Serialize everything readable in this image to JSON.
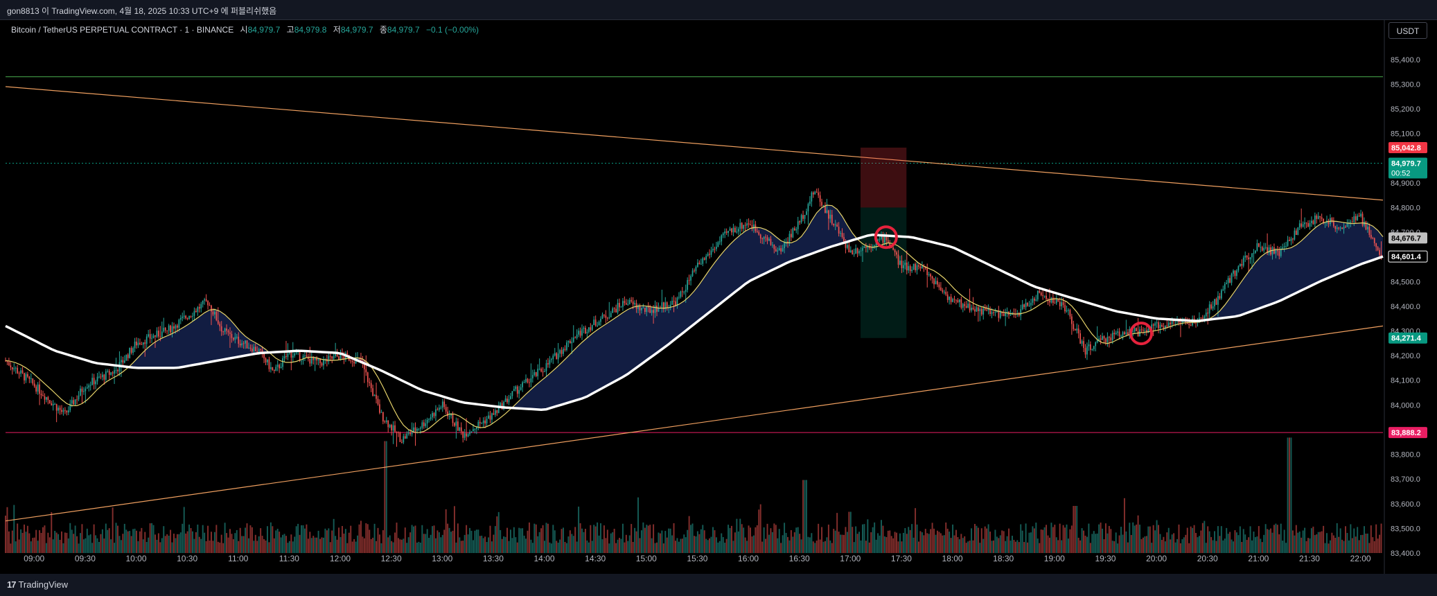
{
  "header": {
    "publish_text": "gon8813 이 TradingView.com, 4월 18, 2025 10:33 UTC+9 에 퍼블리쉬했음"
  },
  "legend": {
    "symbol": "Bitcoin / TetherUS PERPETUAL CONTRACT · 1 · BINANCE",
    "open_label": "시",
    "open": "84,979.7",
    "high_label": "고",
    "high": "84,979.8",
    "low_label": "저",
    "low": "84,979.7",
    "close_label": "종",
    "close": "84,979.7",
    "change": "−0.1 (−0.00%)"
  },
  "price_scale": {
    "unit": "USDT"
  },
  "footer": {
    "brand": "TradingView",
    "logo_mark": "17"
  },
  "colors": {
    "background": "#000000",
    "candle_up": "#26a69a",
    "candle_down": "#ef5350",
    "ema_slow": "#ffffff",
    "ema_fast": "#e6d36a",
    "cloud": "#1a2a5e",
    "trendline": "#f0a060",
    "horizontal_support": "#e91e63",
    "horizontal_top": "#4caf50",
    "marker_circle": "#e5223c"
  },
  "chart_data": {
    "type": "candlestick",
    "symbol": "BTCUSDT.P",
    "timeframe": "1",
    "y_axis": {
      "ylim": [
        83400,
        85450
      ],
      "ticks": [
        "85,400.0",
        "85,300.0",
        "85,200.0",
        "85,100.0",
        "84,900.0",
        "84,800.0",
        "84,700.0",
        "84,500.0",
        "84,400.0",
        "84,300.0",
        "84,200.0",
        "84,100.0",
        "84,000.0",
        "83,800.0",
        "83,700.0",
        "83,600.0",
        "83,500.0",
        "83,400.0"
      ],
      "tick_values": [
        85400,
        85300,
        85200,
        85100,
        84900,
        84800,
        84700,
        84500,
        84400,
        84300,
        84200,
        84100,
        84000,
        83800,
        83700,
        83600,
        83500,
        83400
      ]
    },
    "x_axis": {
      "ticks": [
        "09:00",
        "09:30",
        "10:00",
        "10:30",
        "11:00",
        "11:30",
        "12:00",
        "12:30",
        "13:00",
        "13:30",
        "14:00",
        "14:30",
        "15:00",
        "15:30",
        "16:00",
        "16:30",
        "17:00",
        "17:30",
        "18:00",
        "18:30",
        "19:00",
        "19:30",
        "20:00",
        "20:30",
        "21:00",
        "21:30",
        "22:00"
      ],
      "tick_hours": [
        9,
        9.5,
        10,
        10.5,
        11,
        11.5,
        12,
        12.5,
        13,
        13.5,
        14,
        14.5,
        15,
        15.5,
        16,
        16.5,
        17,
        17.5,
        18,
        18.5,
        19,
        19.5,
        20,
        20.5,
        21,
        21.5,
        22
      ]
    },
    "time_range": [
      8.72,
      22.22
    ],
    "price_path": [
      [
        8.72,
        84180
      ],
      [
        9.0,
        84080
      ],
      [
        9.3,
        83960
      ],
      [
        9.5,
        84080
      ],
      [
        9.8,
        84140
      ],
      [
        10.0,
        84250
      ],
      [
        10.3,
        84300
      ],
      [
        10.5,
        84360
      ],
      [
        10.7,
        84420
      ],
      [
        10.85,
        84300
      ],
      [
        11.0,
        84260
      ],
      [
        11.2,
        84220
      ],
      [
        11.35,
        84130
      ],
      [
        11.5,
        84210
      ],
      [
        11.8,
        84170
      ],
      [
        12.0,
        84200
      ],
      [
        12.2,
        84180
      ],
      [
        12.4,
        83960
      ],
      [
        12.6,
        83860
      ],
      [
        12.8,
        83920
      ],
      [
        13.0,
        84000
      ],
      [
        13.2,
        83880
      ],
      [
        13.5,
        83960
      ],
      [
        13.7,
        84050
      ],
      [
        14.0,
        84150
      ],
      [
        14.3,
        84280
      ],
      [
        14.6,
        84360
      ],
      [
        14.8,
        84420
      ],
      [
        15.0,
        84380
      ],
      [
        15.3,
        84420
      ],
      [
        15.5,
        84560
      ],
      [
        15.8,
        84700
      ],
      [
        16.0,
        84740
      ],
      [
        16.3,
        84620
      ],
      [
        16.5,
        84740
      ],
      [
        16.65,
        84870
      ],
      [
        16.8,
        84760
      ],
      [
        17.0,
        84620
      ],
      [
        17.2,
        84650
      ],
      [
        17.35,
        84680
      ],
      [
        17.5,
        84560
      ],
      [
        17.7,
        84560
      ],
      [
        18.0,
        84420
      ],
      [
        18.3,
        84380
      ],
      [
        18.6,
        84360
      ],
      [
        18.85,
        84450
      ],
      [
        19.1,
        84400
      ],
      [
        19.3,
        84220
      ],
      [
        19.5,
        84270
      ],
      [
        19.7,
        84300
      ],
      [
        19.85,
        84290
      ],
      [
        20.0,
        84320
      ],
      [
        20.2,
        84340
      ],
      [
        20.4,
        84330
      ],
      [
        20.6,
        84430
      ],
      [
        20.8,
        84560
      ],
      [
        21.0,
        84650
      ],
      [
        21.2,
        84610
      ],
      [
        21.4,
        84720
      ],
      [
        21.6,
        84760
      ],
      [
        21.8,
        84720
      ],
      [
        22.0,
        84760
      ],
      [
        22.22,
        84590
      ]
    ],
    "ema_slow": [
      [
        8.72,
        84320
      ],
      [
        9.2,
        84220
      ],
      [
        9.6,
        84170
      ],
      [
        10.0,
        84150
      ],
      [
        10.4,
        84150
      ],
      [
        10.8,
        84180
      ],
      [
        11.2,
        84210
      ],
      [
        11.6,
        84220
      ],
      [
        12.0,
        84210
      ],
      [
        12.4,
        84140
      ],
      [
        12.8,
        84060
      ],
      [
        13.2,
        84010
      ],
      [
        13.6,
        83990
      ],
      [
        14.0,
        83980
      ],
      [
        14.4,
        84030
      ],
      [
        14.8,
        84120
      ],
      [
        15.2,
        84240
      ],
      [
        15.6,
        84370
      ],
      [
        16.0,
        84500
      ],
      [
        16.4,
        84580
      ],
      [
        16.8,
        84640
      ],
      [
        17.2,
        84690
      ],
      [
        17.6,
        84680
      ],
      [
        18.0,
        84640
      ],
      [
        18.4,
        84560
      ],
      [
        18.8,
        84480
      ],
      [
        19.2,
        84430
      ],
      [
        19.6,
        84380
      ],
      [
        20.0,
        84350
      ],
      [
        20.4,
        84340
      ],
      [
        20.8,
        84360
      ],
      [
        21.2,
        84420
      ],
      [
        21.6,
        84500
      ],
      [
        22.0,
        84570
      ],
      [
        22.22,
        84601.4
      ]
    ],
    "markers": [
      {
        "type": "circle",
        "time": 17.35,
        "price": 84680
      },
      {
        "type": "circle",
        "time": 19.85,
        "price": 84290
      }
    ],
    "position_tool": {
      "time_start": 17.1,
      "time_end": 17.55,
      "entry": 84800,
      "target_top": 85042.8,
      "stop_bottom": 84271.4
    },
    "trendlines": [
      {
        "from": [
          8.72,
          85290
        ],
        "to": [
          22.22,
          84830
        ],
        "color": "#f0a060"
      },
      {
        "from": [
          8.72,
          83530
        ],
        "to": [
          22.22,
          84320
        ],
        "color": "#f0a060"
      }
    ],
    "horizontal_lines": [
      {
        "price": 83888.2,
        "color": "#e91e63"
      },
      {
        "price": 85330,
        "color": "#4caf50"
      }
    ],
    "volume_spikes": [
      [
        12.45,
        0.95
      ],
      [
        16.55,
        0.62
      ],
      [
        21.3,
        0.98
      ],
      [
        17.0,
        0.35
      ],
      [
        19.2,
        0.4
      ]
    ],
    "price_labels": [
      {
        "text": "85,042.8",
        "price": 85042.8,
        "bg": "#f23645",
        "fg": "#ffffff"
      },
      {
        "text": "84,979.7",
        "price": 84979.7,
        "bg": "#089981",
        "fg": "#ffffff",
        "sub": "00:52"
      },
      {
        "text": "84,676.7",
        "price": 84676.7,
        "bg": "#c0c0c0",
        "fg": "#000000"
      },
      {
        "text": "84,601.4",
        "price": 84601.4,
        "bg": "#000000",
        "fg": "#ffffff",
        "border": "#ffffff"
      },
      {
        "text": "84,271.4",
        "price": 84271.4,
        "bg": "#089981",
        "fg": "#ffffff"
      },
      {
        "text": "83,888.2",
        "price": 83888.2,
        "bg": "#e91e63",
        "fg": "#ffffff"
      }
    ],
    "legend_placement": "top-left",
    "grid": false
  }
}
